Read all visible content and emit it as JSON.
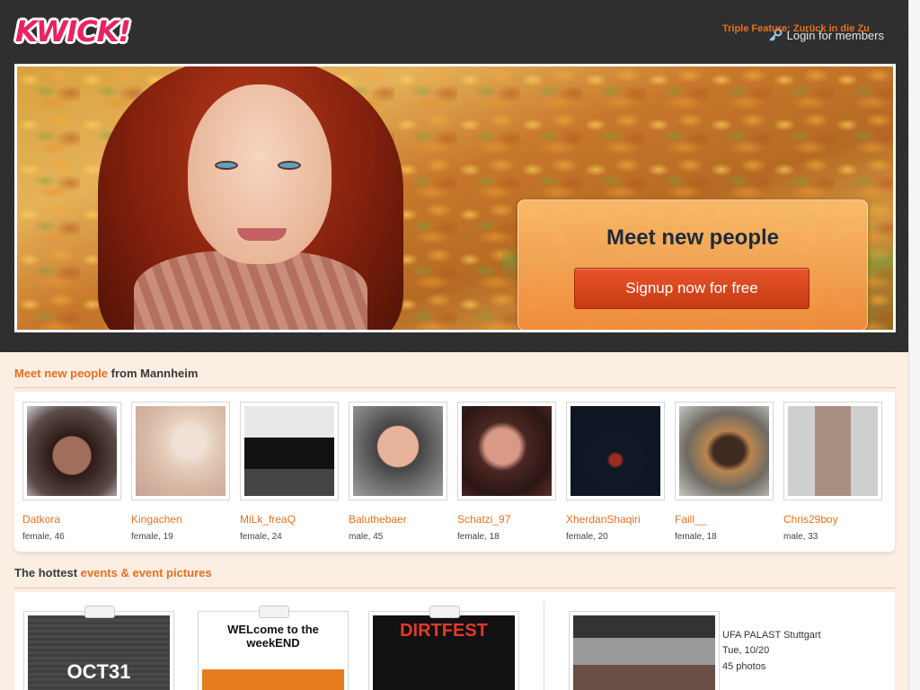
{
  "header": {
    "logo_text": "KWICK!",
    "login_label": "Login for members"
  },
  "hero": {
    "title": "Meet new people",
    "signup_label": "Signup now for free"
  },
  "section_people": {
    "title_accent": "Meet new people",
    "title_rest": " from Mannheim",
    "people": [
      {
        "name": "Datkora",
        "info": "female, 46"
      },
      {
        "name": "Kingachen",
        "info": "female, 19"
      },
      {
        "name": "MiLk_freaQ",
        "info": "female, 24"
      },
      {
        "name": "Baluthebaer",
        "info": "male, 45"
      },
      {
        "name": "Schatzi_97",
        "info": "female, 18"
      },
      {
        "name": "XherdanShaqiri",
        "info": "female, 20"
      },
      {
        "name": "Faill__",
        "info": "female, 18"
      },
      {
        "name": "Chris29boy",
        "info": "male, 33"
      }
    ]
  },
  "section_events": {
    "title_rest": "The hottest ",
    "title_accent": "events & event pictures",
    "flyers": [
      {
        "text": "OCT31"
      },
      {
        "text": "WELcome to the weekEND"
      },
      {
        "text": "DIRTFEST"
      }
    ],
    "featured": {
      "title": "Triple Feature: Zurück in die Zu",
      "venue": "UFA PALAST Stuttgart",
      "date": "Tue, 10/20",
      "photos": "45 photos"
    }
  },
  "colors": {
    "accent": "#e6701e",
    "header_bg": "#2e2e2e",
    "cta_button": "#d4461b"
  }
}
